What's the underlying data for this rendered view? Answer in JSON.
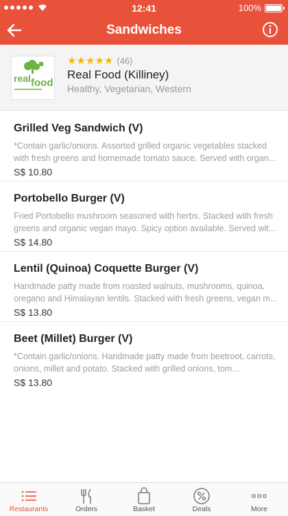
{
  "status_bar": {
    "time": "12:41",
    "battery": "100%"
  },
  "nav": {
    "title": "Sandwiches",
    "back_icon": "back-arrow-icon",
    "info_icon": "info-icon"
  },
  "restaurant": {
    "logo_text_top": "real",
    "logo_text_bottom": "food",
    "stars": "★★★★★",
    "rating_count": "(46)",
    "name": "Real Food (Killiney)",
    "tags": "Healthy, Vegetarian, Western"
  },
  "menu": {
    "items": [
      {
        "name": "Grilled Veg Sandwich (V)",
        "description": "*Contain garlic/onions. Assorted grilled organic vegetables stacked with fresh greens and homemade tomato sauce. Served with organ...",
        "price": "S$ 10.80"
      },
      {
        "name": "Portobello Burger (V)",
        "description": "Fried Portobello mushroom seasoned with herbs. Stacked with fresh greens and organic vegan mayo. Spicy option available. Served wit...",
        "price": "S$ 14.80"
      },
      {
        "name": "Lentil (Quinoa) Coquette Burger (V)",
        "description": "Handmade patty made from roasted walnuts, mushrooms, quinoa, oregano and Himalayan lentils. Stacked with fresh greens, vegan m...",
        "price": "S$ 13.80"
      },
      {
        "name": "Beet (Millet) Burger (V)",
        "description": "*Contain garlic/onions. Handmade patty made from beetroot, carrots, onions, millet and potato. Stacked with grilled onions, tom...",
        "price": "S$ 13.80"
      }
    ]
  },
  "tabs": [
    {
      "label": "Restaurants",
      "icon": "list-icon",
      "active": true
    },
    {
      "label": "Orders",
      "icon": "fork-knife-icon",
      "active": false
    },
    {
      "label": "Basket",
      "icon": "basket-icon",
      "active": false
    },
    {
      "label": "Deals",
      "icon": "percent-icon",
      "active": false
    },
    {
      "label": "More",
      "icon": "more-dots-icon",
      "active": false
    }
  ],
  "colors": {
    "brand": "#e8523b",
    "star": "#f5b800",
    "logo_green": "#6cb33f"
  }
}
